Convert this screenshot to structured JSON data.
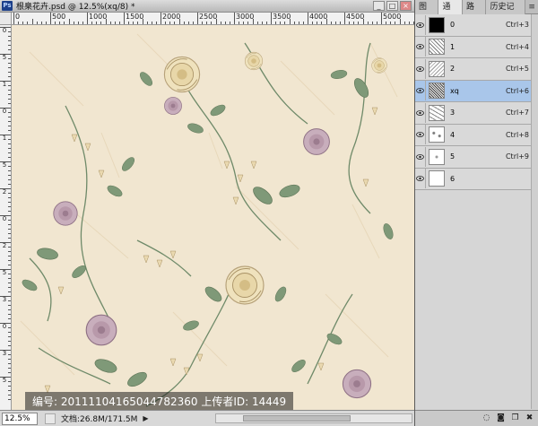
{
  "app": {
    "badge": "Ps"
  },
  "document": {
    "title": "根臬花卉.psd @ 12.5%(xq/8) *",
    "window_buttons": [
      "_",
      "□",
      "×"
    ],
    "ruler_h_labels": [
      "0",
      "500",
      "1000",
      "1500",
      "2000",
      "2500",
      "3000",
      "3500",
      "4000",
      "4500",
      "5000"
    ],
    "ruler_v_labels": [
      "0",
      "5",
      "1",
      "0",
      "1",
      "5",
      "2",
      "0",
      "2",
      "5",
      "3",
      "0",
      "3",
      "5"
    ],
    "zoom": "12.5%",
    "doc_info": "文档:26.8M/171.5M",
    "status_arrow": "▶"
  },
  "watermark": "编号: 20111104165044782360 上传者ID: 14449",
  "panel": {
    "tabs": [
      "图层",
      "通道",
      "路径",
      "历史记录"
    ],
    "active_tab": 1,
    "menu_icon": "≡",
    "channels": [
      {
        "name": "0",
        "shortcut": "Ctrl+3"
      },
      {
        "name": "1",
        "shortcut": "Ctrl+4"
      },
      {
        "name": "2",
        "shortcut": "Ctrl+5"
      },
      {
        "name": "xq",
        "shortcut": "Ctrl+6"
      },
      {
        "name": "3",
        "shortcut": "Ctrl+7"
      },
      {
        "name": "4",
        "shortcut": "Ctrl+8"
      },
      {
        "name": "5",
        "shortcut": "Ctrl+9"
      },
      {
        "name": "6",
        "shortcut": ""
      }
    ],
    "selected_channel": 3,
    "footer_icons": [
      "load-selection-icon",
      "save-selection-icon",
      "new-channel-icon",
      "delete-channel-icon"
    ]
  },
  "colors": {
    "canvas_background": "#f1e6d0",
    "selected_row": "#a9c6ea",
    "flower_pink": "#b79aa6",
    "flower_cream": "#efe2bd",
    "leaf_green": "#7f9978"
  }
}
